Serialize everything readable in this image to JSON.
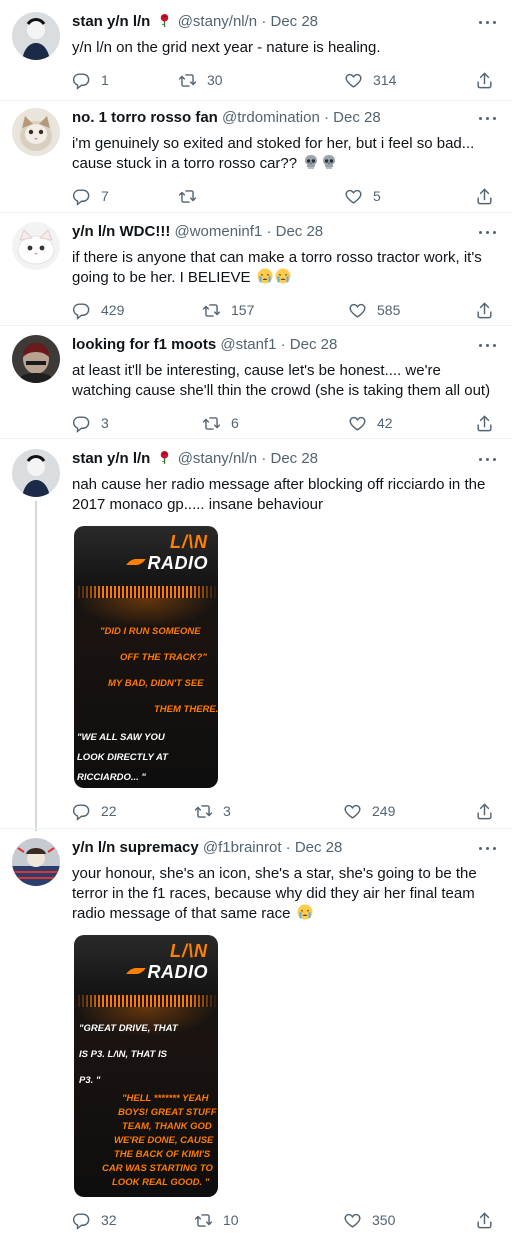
{
  "tweets": [
    {
      "name": "stan y/n l/n",
      "handle": "@stany/nl/n",
      "date": "Dec 28",
      "text": "y/n l/n on the grid next year - nature is healing.",
      "replies": "1",
      "retweets": "30",
      "likes": "314"
    },
    {
      "name": "no. 1 torro rosso fan",
      "handle": "@trdomination",
      "date": "Dec 28",
      "text_line1": "i'm genuinely so exited and stoked for her, but i feel so bad...",
      "text_line2": "cause stuck in a torro rosso car??",
      "replies": "7",
      "retweets": "",
      "likes": "5"
    },
    {
      "name": "y/n l/n WDC!!!",
      "handle": "@womeninf1",
      "date": "Dec 28",
      "text_line1": "if there is anyone that can make a torro rosso tractor work, it's",
      "text_line2": "going to be her. I BELIEVE",
      "replies": "429",
      "retweets": "157",
      "likes": "585"
    },
    {
      "name": "looking for f1 moots",
      "handle": "@stanf1",
      "date": "Dec 28",
      "text_line1": "at least it'll be interesting, cause let's be honest.... we're",
      "text_line2": "watching cause she'll thin the crowd (she is taking them all out)",
      "replies": "3",
      "retweets": "6",
      "likes": "42"
    },
    {
      "name": "stan y/n l/n",
      "handle": "@stany/nl/n",
      "date": "Dec 28",
      "text_line1": "nah cause her radio message after blocking off ricciardo in the",
      "text_line2": "2017 monaco gp..... insane behaviour",
      "card": {
        "logo_top": "L/\\N",
        "logo_bottom": "RADIO",
        "lines": [
          "\"DID I RUN SOMEONE",
          "OFF THE TRACK?\"",
          "MY BAD, DIDN'T SEE",
          "THEM THERE.'",
          "\"WE ALL SAW YOU",
          "LOOK DIRECTLY AT",
          "RICCIARDO... \""
        ]
      },
      "replies": "22",
      "retweets": "3",
      "likes": "249"
    },
    {
      "name": "y/n l/n supremacy",
      "handle": "@f1brainrot",
      "date": "Dec 28",
      "text_line1": "your honour, she's an icon, she's a star, she's going to be the",
      "text_line2": "terror in the f1 races, because why did they air her final team",
      "text_line3": "radio message of that same race",
      "card": {
        "logo_top": "L/\\N",
        "logo_bottom": "RADIO",
        "lines": [
          "\"GREAT DRIVE, THAT",
          "IS P3. L/\\N, THAT IS",
          "P3. \"",
          "\"HELL ******* YEAH",
          "BOYS! GREAT STUFF",
          "TEAM, THANK GOD",
          "WE'RE DONE, CAUSE",
          "THE BACK OF KIMI'S",
          "CAR WAS STARTING TO",
          "LOOK REAL GOOD. \""
        ]
      },
      "replies": "32",
      "retweets": "10",
      "likes": "350"
    }
  ],
  "colors": {
    "text": "#0f1419",
    "muted": "#536471",
    "line": "#cfd9de",
    "mclaren_orange": "#ff8000",
    "rose": "#c8102e"
  },
  "icons": [
    "rose-icon",
    "more-icon",
    "reply-icon",
    "retweet-icon",
    "like-icon",
    "share-icon",
    "skull-emoji",
    "sob-emoji"
  ]
}
